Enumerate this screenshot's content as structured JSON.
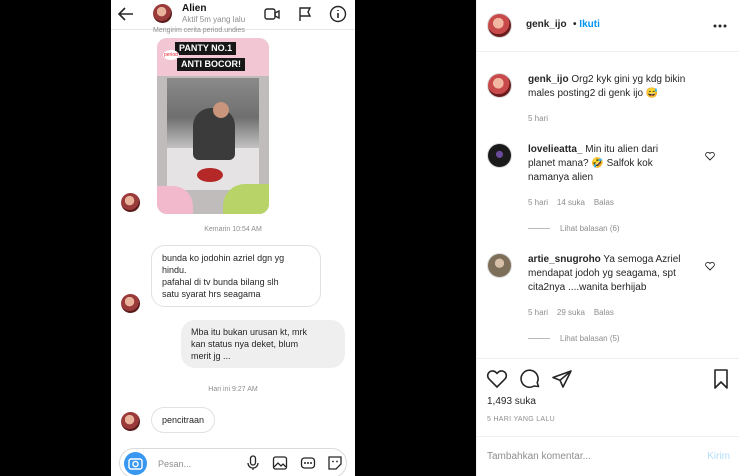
{
  "phone": {
    "contact_name": "Alien",
    "contact_status": "Aktif 5m yang lalu",
    "story_caption": "Mengirim cerita period.undies",
    "story_line1": "PANTY NO.1",
    "story_line2": "ANTI BOCOR!",
    "story_brand": "period",
    "time1": "Kemarin 10:54 AM",
    "msg1_lines": [
      "bunda ko jodohin azriel dgn yg",
      "hindu.",
      "pafahal di tv bunda bilang slh",
      "satu syarat hrs seagama"
    ],
    "msg2_lines": [
      "Mba itu bukan urusan kt, mrk",
      "kan status nya deket, blum",
      "merit jg ..."
    ],
    "time2": "Hari ini 9:27 AM",
    "msg3": "pencitraan",
    "composer_placeholder": "Pesan..."
  },
  "post": {
    "author": "genk_ijo",
    "follow_label": "Ikuti",
    "follow_separator": "•",
    "caption_user": "genk_ijo",
    "caption_lines": [
      "Org2 kyk gini yg kdg bikin",
      "males posting2 di genk ijo 😅"
    ],
    "caption_age": "5 hari",
    "comments": [
      {
        "user": "lovelieatta_",
        "lines": [
          "Min itu alien dari",
          "planet mana? 🤣 Salfok kok",
          "namanya alien"
        ],
        "age": "5 hari",
        "likes": "14 suka",
        "reply": "Balas",
        "view_replies": "Lihat balasan (6)"
      },
      {
        "user": "artie_snugroho",
        "lines": [
          "Ya semoga Azriel",
          "mendapat jodoh yg seagama, spt",
          "cita2nya ....wanita berhijab"
        ],
        "age": "5 hari",
        "likes": "29 suka",
        "reply": "Balas",
        "view_replies": "Lihat balasan (5)"
      }
    ],
    "like_count": "1,493 suka",
    "posted_ago": "5 HARI YANG LALU",
    "add_comment_placeholder": "Tambahkan komentar...",
    "post_button": "Kirim",
    "accent_color": "#0095f6"
  }
}
